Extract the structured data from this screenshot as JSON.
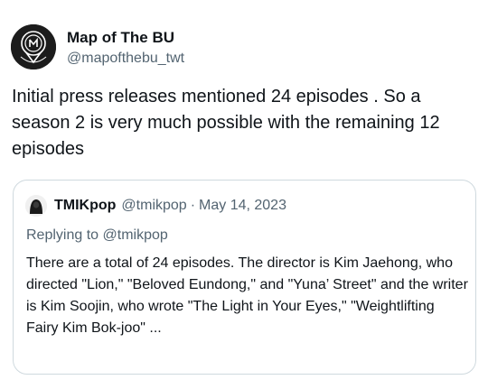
{
  "author": {
    "display_name": "Map of The BU",
    "handle": "@mapofthebu_twt"
  },
  "tweet": {
    "text": "Initial press releases mentioned 24 episodes . So a season 2 is very much possible with the remaining 12 episodes"
  },
  "quoted": {
    "display_name": "TMIKpop",
    "handle": "@tmikpop",
    "separator": "·",
    "date": "May 14, 2023",
    "replying_prefix": "Replying to ",
    "replying_handle": "@tmikpop",
    "text": "There are a total of 24 episodes. The director is Kim Jaehong, who directed \"Lion,\" \"Beloved Eundong,\" and \"Yuna’ Street\" and the writer is Kim Soojin, who wrote \"The Light in Your Eyes,\" \"Weightlifting Fairy Kim Bok-joo\" ..."
  },
  "icons": {
    "author_avatar": "map-pin-logo-icon",
    "quoted_avatar": "hooded-figure-icon"
  }
}
